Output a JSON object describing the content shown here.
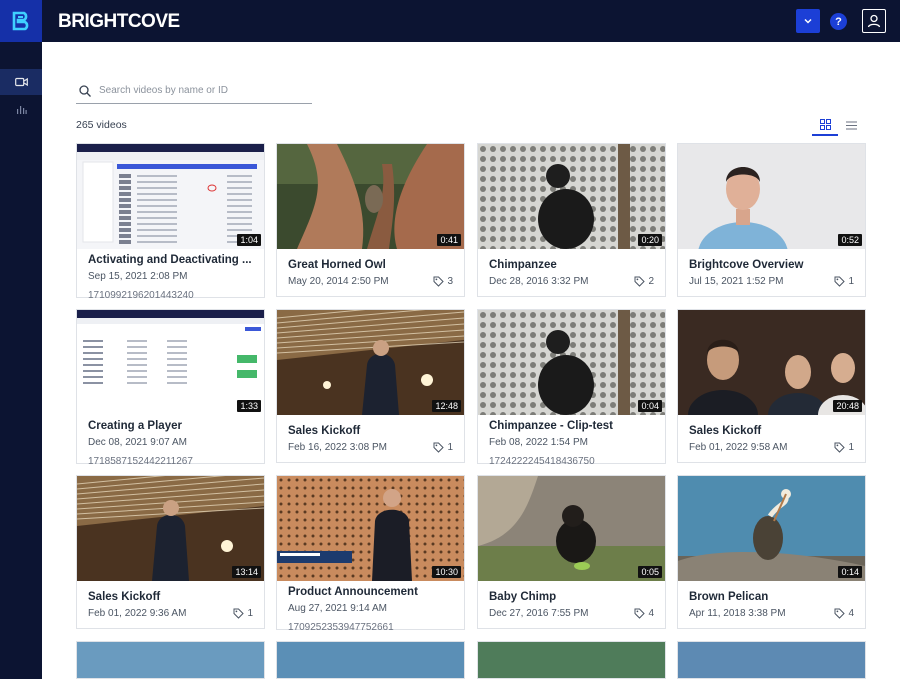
{
  "header": {
    "brand": "BRIGHTCOVE",
    "help_label": "?"
  },
  "search": {
    "placeholder": "Search videos by name or ID"
  },
  "video_count": "265 videos",
  "videos": [
    {
      "title": "Activating and Deactivating ...",
      "date": "Sep 15, 2021 2:08 PM",
      "id": "1710992196201443240",
      "duration": "1:04",
      "tags": ""
    },
    {
      "title": "Great Horned Owl",
      "date": "May 20, 2014 2:50 PM",
      "id": "",
      "duration": "0:41",
      "tags": "3"
    },
    {
      "title": "Chimpanzee",
      "date": "Dec 28, 2016 3:32 PM",
      "id": "",
      "duration": "0:20",
      "tags": "2"
    },
    {
      "title": "Brightcove Overview",
      "date": "Jul 15, 2021 1:52 PM",
      "id": "",
      "duration": "0:52",
      "tags": "1"
    },
    {
      "title": "Creating a Player",
      "date": "Dec 08, 2021 9:07 AM",
      "id": "1718587152442211267",
      "duration": "1:33",
      "tags": ""
    },
    {
      "title": "Sales Kickoff",
      "date": "Feb 16, 2022 3:08 PM",
      "id": "",
      "duration": "12:48",
      "tags": "1"
    },
    {
      "title": "Chimpanzee - Clip-test",
      "date": "Feb 08, 2022 1:54 PM",
      "id": "1724222245418436750",
      "duration": "0:04",
      "tags": ""
    },
    {
      "title": "Sales Kickoff",
      "date": "Feb 01, 2022 9:58 AM",
      "id": "",
      "duration": "20:48",
      "tags": "1"
    },
    {
      "title": "Sales Kickoff",
      "date": "Feb 01, 2022 9:36 AM",
      "id": "",
      "duration": "13:14",
      "tags": "1"
    },
    {
      "title": "Product Announcement",
      "date": "Aug 27, 2021 9:14 AM",
      "id": "1709252353947752661",
      "duration": "10:30",
      "tags": ""
    },
    {
      "title": "Baby Chimp",
      "date": "Dec 27, 2016 7:55 PM",
      "id": "",
      "duration": "0:05",
      "tags": "4"
    },
    {
      "title": "Brown Pelican",
      "date": "Apr 11, 2018 3:38 PM",
      "id": "",
      "duration": "0:14",
      "tags": "4"
    }
  ],
  "colors": {
    "nav_bg": "#0c1432",
    "accent": "#1c3fd6"
  }
}
